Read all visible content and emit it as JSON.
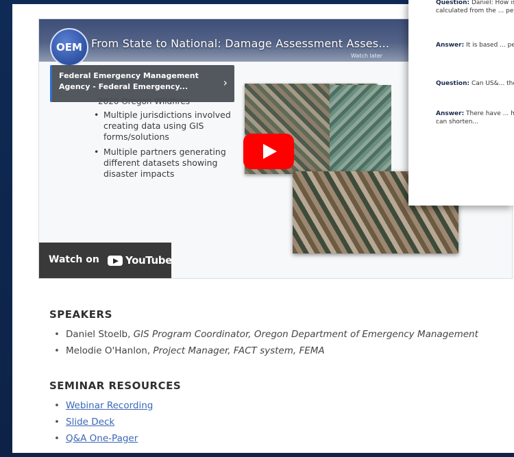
{
  "video": {
    "logo_text": "OEM",
    "title": "From State to National: Damage Assessment Asses...",
    "subtitle": "Watch later",
    "playlist_card": "Federal Emergency Management Agency - Federal Emergency...",
    "slide_heading": "2020 Oregon Wildfires",
    "slide_bullets": [
      "Multiple jurisdictions involved creating data using GIS forms/solutions",
      "Multiple partners generating different datasets showing disaster impacts"
    ],
    "watch_label": "Watch on",
    "youtube_word": "YouTube"
  },
  "qa": {
    "q1_label": "Question:",
    "q1_text": " Daniel: How is the damage percentage calculated from the ... percentage?",
    "a1_label": "Answer:",
    "a1_text": " It is based ... percentage totals to ...",
    "q2_label": "Question:",
    "q2_text": " Can US&... the FEMA FACTS sy...",
    "a2_label": "Answer:",
    "a2_text": " There have ... help inform PDAs. T... own but can shorten..."
  },
  "speakers": {
    "heading": "SPEAKERS",
    "items": [
      {
        "name": "Daniel Stoelb, ",
        "role": "GIS Program Coordinator, Oregon Department of Emergency Management"
      },
      {
        "name": "Melodie O'Hanlon, ",
        "role": "Project Manager, FACT system, FEMA"
      }
    ]
  },
  "resources": {
    "heading": "SEMINAR RESOURCES",
    "links": [
      "Webinar Recording",
      "Slide Deck",
      "Q&A One-Pager"
    ]
  }
}
